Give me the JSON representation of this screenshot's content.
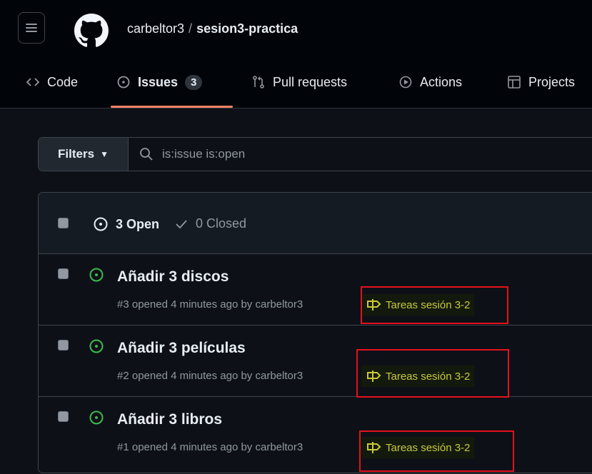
{
  "header": {
    "owner": "carbeltor3",
    "separator": "/",
    "repo": "sesion3-practica"
  },
  "nav": {
    "tabs": [
      {
        "label": "Code"
      },
      {
        "label": "Issues",
        "count": "3"
      },
      {
        "label": "Pull requests"
      },
      {
        "label": "Actions"
      },
      {
        "label": "Projects"
      }
    ]
  },
  "filter": {
    "button_label": "Filters",
    "query": "is:issue is:open"
  },
  "list": {
    "open_label": "3 Open",
    "closed_label": "0 Closed",
    "issues": [
      {
        "title": "Añadir 3 discos",
        "meta": "#3 opened 4 minutes ago by carbeltor3",
        "milestone": "Tareas sesión 3-2"
      },
      {
        "title": "Añadir 3 películas",
        "meta": "#2 opened 4 minutes ago by carbeltor3",
        "milestone": "Tareas sesión 3-2"
      },
      {
        "title": "Añadir 3 libros",
        "meta": "#1 opened 4 minutes ago by carbeltor3",
        "milestone": "Tareas sesión 3-2"
      }
    ]
  },
  "colors": {
    "background": "#0d1117",
    "accent_underline": "#f78166",
    "open_green": "#3fb950",
    "milestone_text": "#c9c93a",
    "highlight_red": "#e5101c"
  },
  "icons": {
    "menu": "hamburger-icon",
    "logo": "github-icon",
    "code": "code-icon",
    "issues": "issue-opened-icon",
    "pulls": "git-pull-request-icon",
    "actions": "play-icon",
    "projects": "table-icon",
    "search": "search-icon",
    "closed": "check-icon",
    "milestone": "milestone-icon"
  }
}
